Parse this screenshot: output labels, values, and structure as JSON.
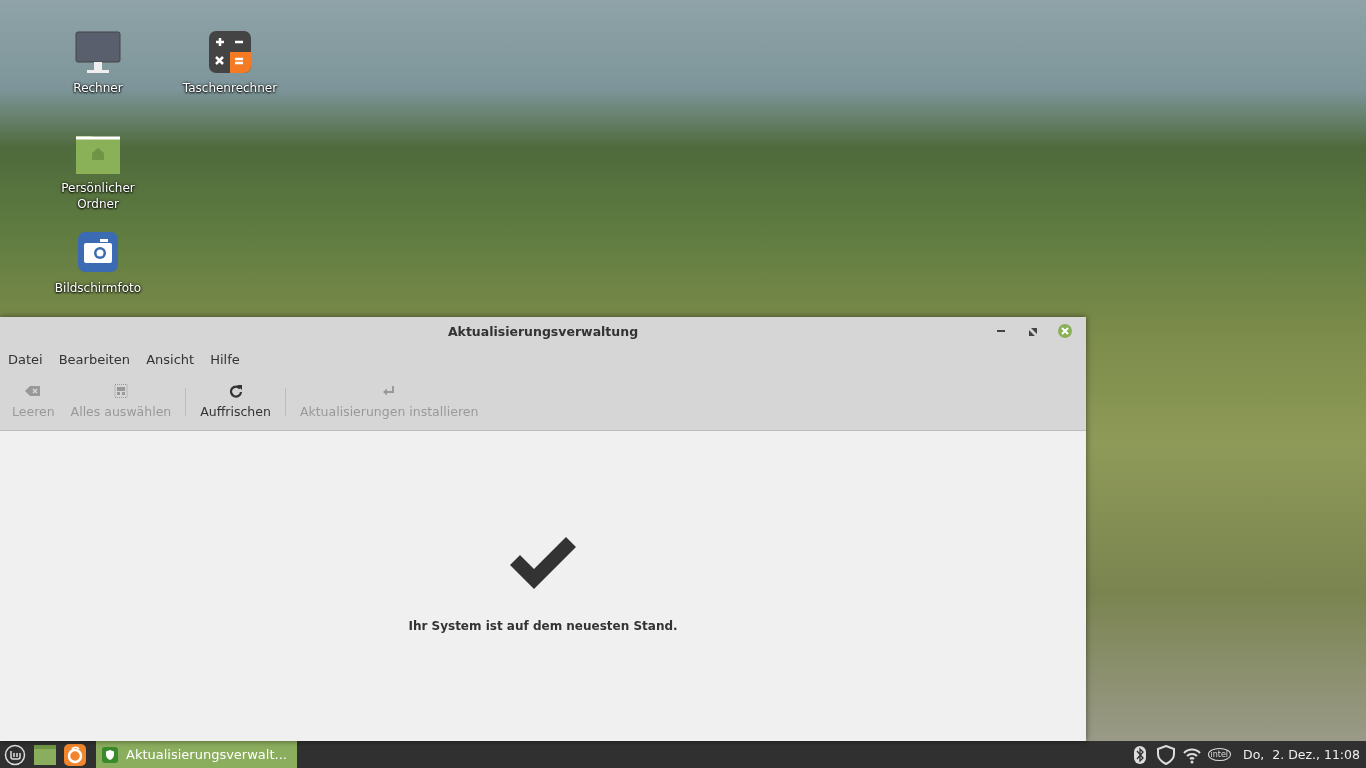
{
  "desktop": {
    "icons": [
      {
        "kind": "monitor",
        "label": "Rechner"
      },
      {
        "kind": "folder",
        "label": "Persönlicher Ordner"
      },
      {
        "kind": "camera",
        "label": "Bildschirmfoto"
      },
      {
        "kind": "calculator",
        "label": "Taschenrechner"
      }
    ]
  },
  "window": {
    "title": "Aktualisierungsverwaltung",
    "menu": [
      "Datei",
      "Bearbeiten",
      "Ansicht",
      "Hilfe"
    ],
    "toolbar": [
      {
        "kind": "clear",
        "label": "Leeren",
        "disabled": true,
        "separator_before": false
      },
      {
        "kind": "select-all",
        "label": "Alles auswählen",
        "disabled": true,
        "separator_before": false
      },
      {
        "kind": "refresh",
        "label": "Auffrischen",
        "disabled": false,
        "separator_before": true
      },
      {
        "kind": "install",
        "label": "Aktualisierungen installieren",
        "disabled": true,
        "separator_before": true
      }
    ],
    "status": {
      "kind": "ok",
      "message": "Ihr System ist auf dem neuesten Stand."
    }
  },
  "taskbar": {
    "launchers": [
      {
        "kind": "menu"
      },
      {
        "kind": "files"
      },
      {
        "kind": "browser"
      }
    ],
    "tasks": [
      {
        "label": "Aktualisierungsverwalt...",
        "selected": true
      }
    ],
    "tray": {
      "chip_label": "intel",
      "clock": "Do,  2. Dez., 11:08"
    }
  }
}
